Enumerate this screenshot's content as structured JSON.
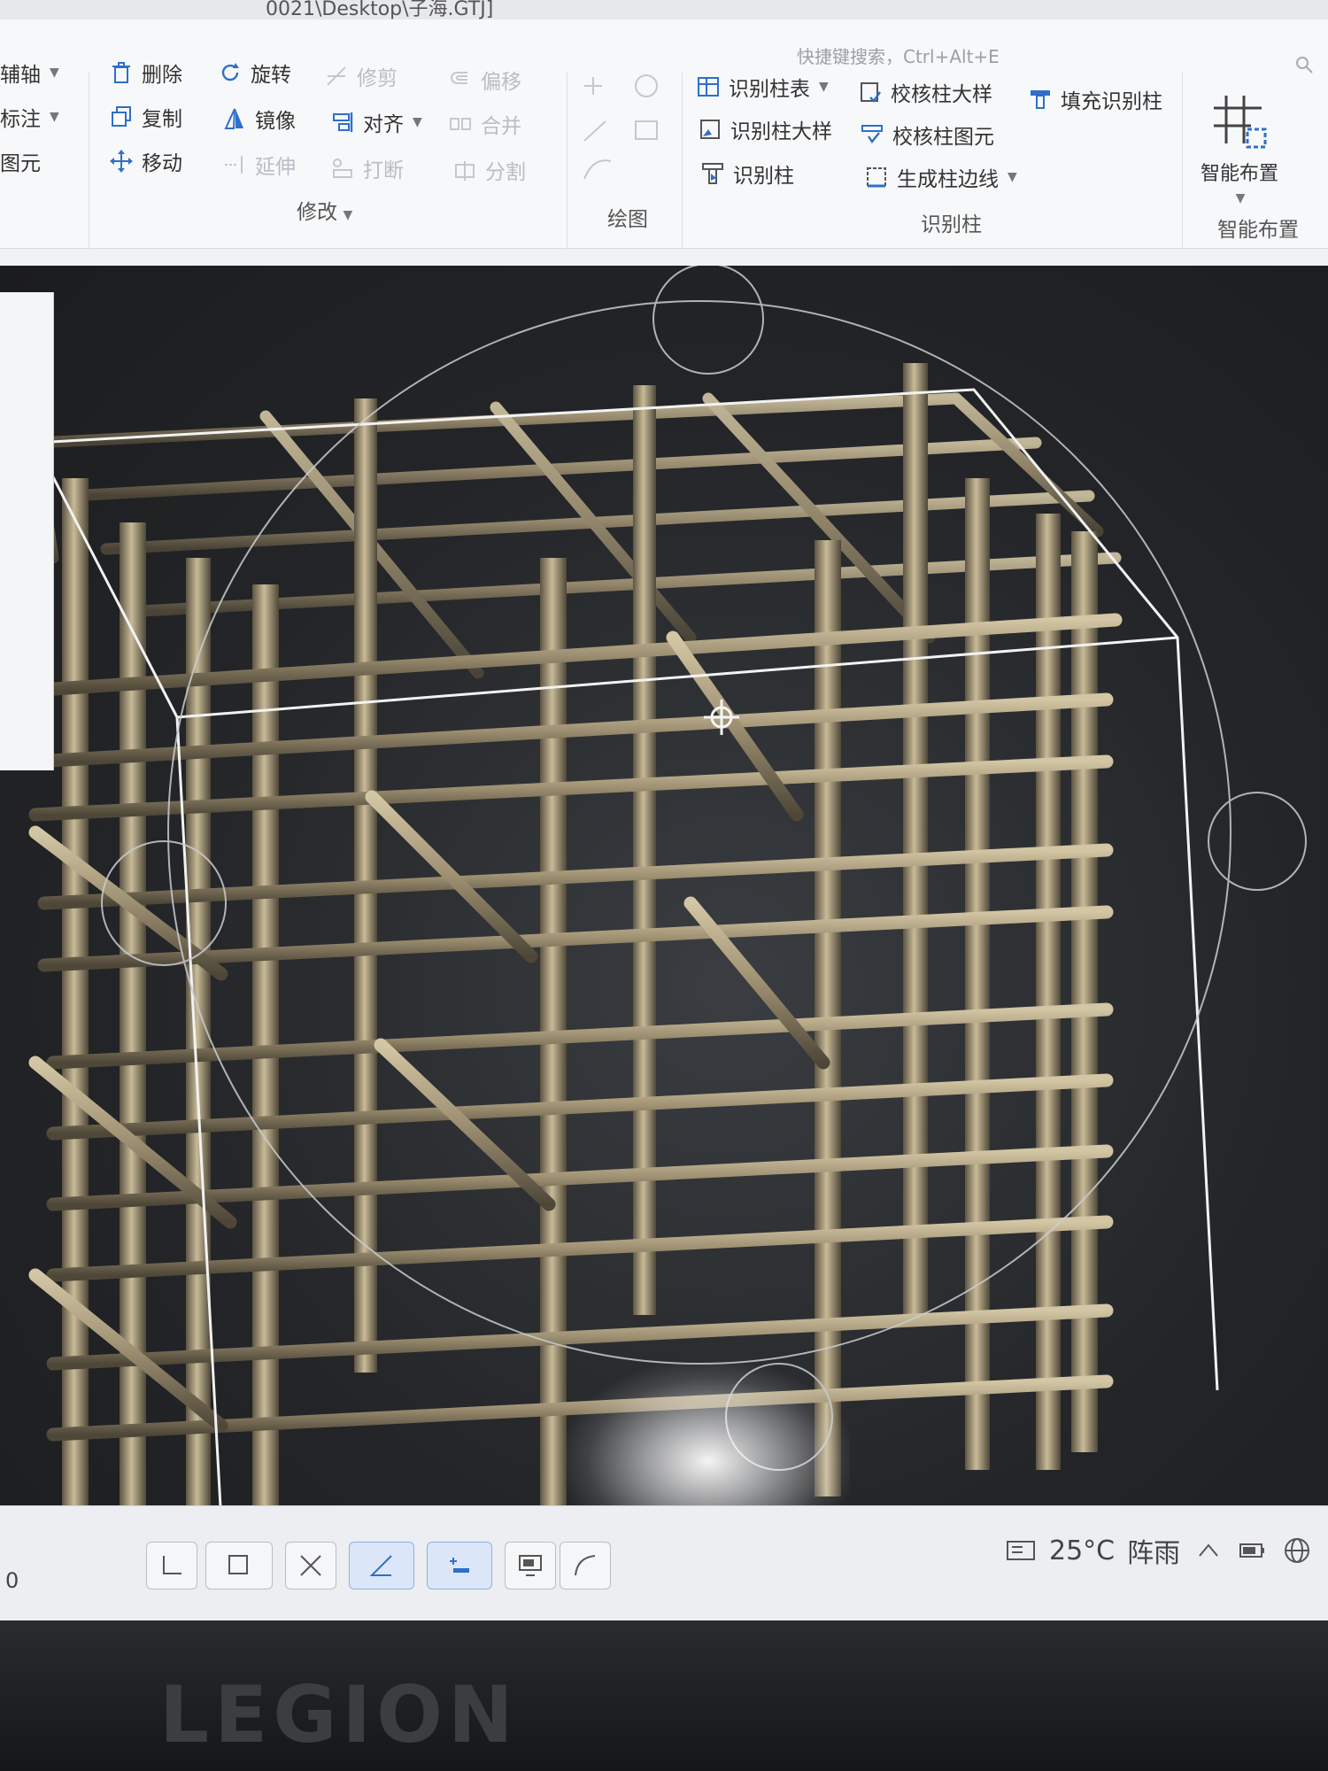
{
  "window": {
    "title_fragment": "0021\\Desktop\\子海.GTJ]"
  },
  "ribbon": {
    "search_hint": "快捷键搜索，Ctrl+Alt+E",
    "left_partial": [
      "辅轴",
      "标注",
      "图元"
    ],
    "modify": {
      "label": "修改",
      "items": {
        "delete": "删除",
        "rotate": "旋转",
        "trim": "修剪",
        "offset": "偏移",
        "copy": "复制",
        "mirror": "镜像",
        "align": "对齐",
        "merge": "合并",
        "move": "移动",
        "extend": "延伸",
        "break": "打断",
        "split": "分割"
      }
    },
    "draw": {
      "label": "绘图"
    },
    "identify_column": {
      "label": "识别柱",
      "items": {
        "identify_table": "识别柱表",
        "check_detail": "校核柱大样",
        "fill_identify": "填充识别柱",
        "identify_detail": "识别柱大样",
        "check_element": "校核柱图元",
        "identify": "识别柱",
        "gen_edge": "生成柱边线"
      }
    },
    "smart": {
      "button": "智能布置",
      "label": "智能布置"
    }
  },
  "viewport": {
    "scene": "rebar-cage-3d"
  },
  "status": {
    "coord": "0",
    "weather_temp": "25°C",
    "weather_text": "阵雨"
  },
  "laptop": {
    "brand": "LEGION"
  },
  "colors": {
    "ribbon_bg": "#f7f8fa",
    "viewport_bg": "#232528",
    "rebar": "#a8997a",
    "accent_blue": "#2f6fc9"
  }
}
